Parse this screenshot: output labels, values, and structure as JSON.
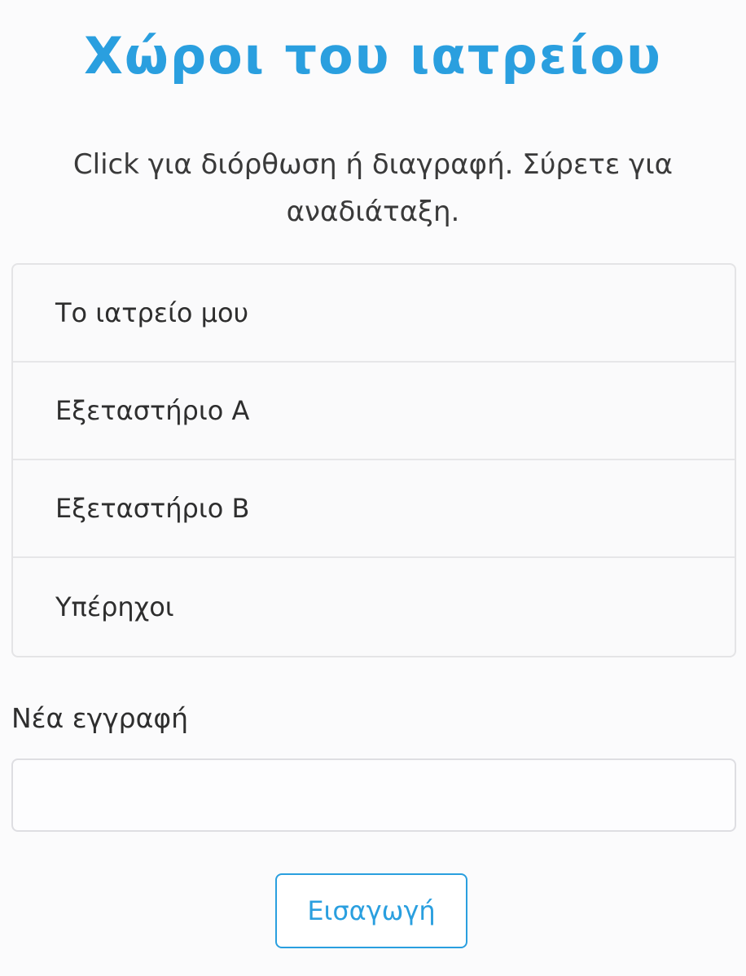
{
  "header": {
    "title": "Χώροι του ιατρείου",
    "subtitle": "Click για διόρθωση ή διαγραφή. Σύρετε για αναδιάταξη."
  },
  "rooms": [
    {
      "label": "Το ιατρείο μου"
    },
    {
      "label": "Εξεταστήριο Α"
    },
    {
      "label": "Εξεταστήριο Β"
    },
    {
      "label": "Υπέρηχοι"
    }
  ],
  "new_entry": {
    "label": "Νέα εγγραφή",
    "value": "",
    "placeholder": ""
  },
  "actions": {
    "submit_label": "Εισαγωγή"
  },
  "colors": {
    "accent": "#2a9fdf",
    "background": "#fbfbfc",
    "border": "#e4e4e6"
  }
}
